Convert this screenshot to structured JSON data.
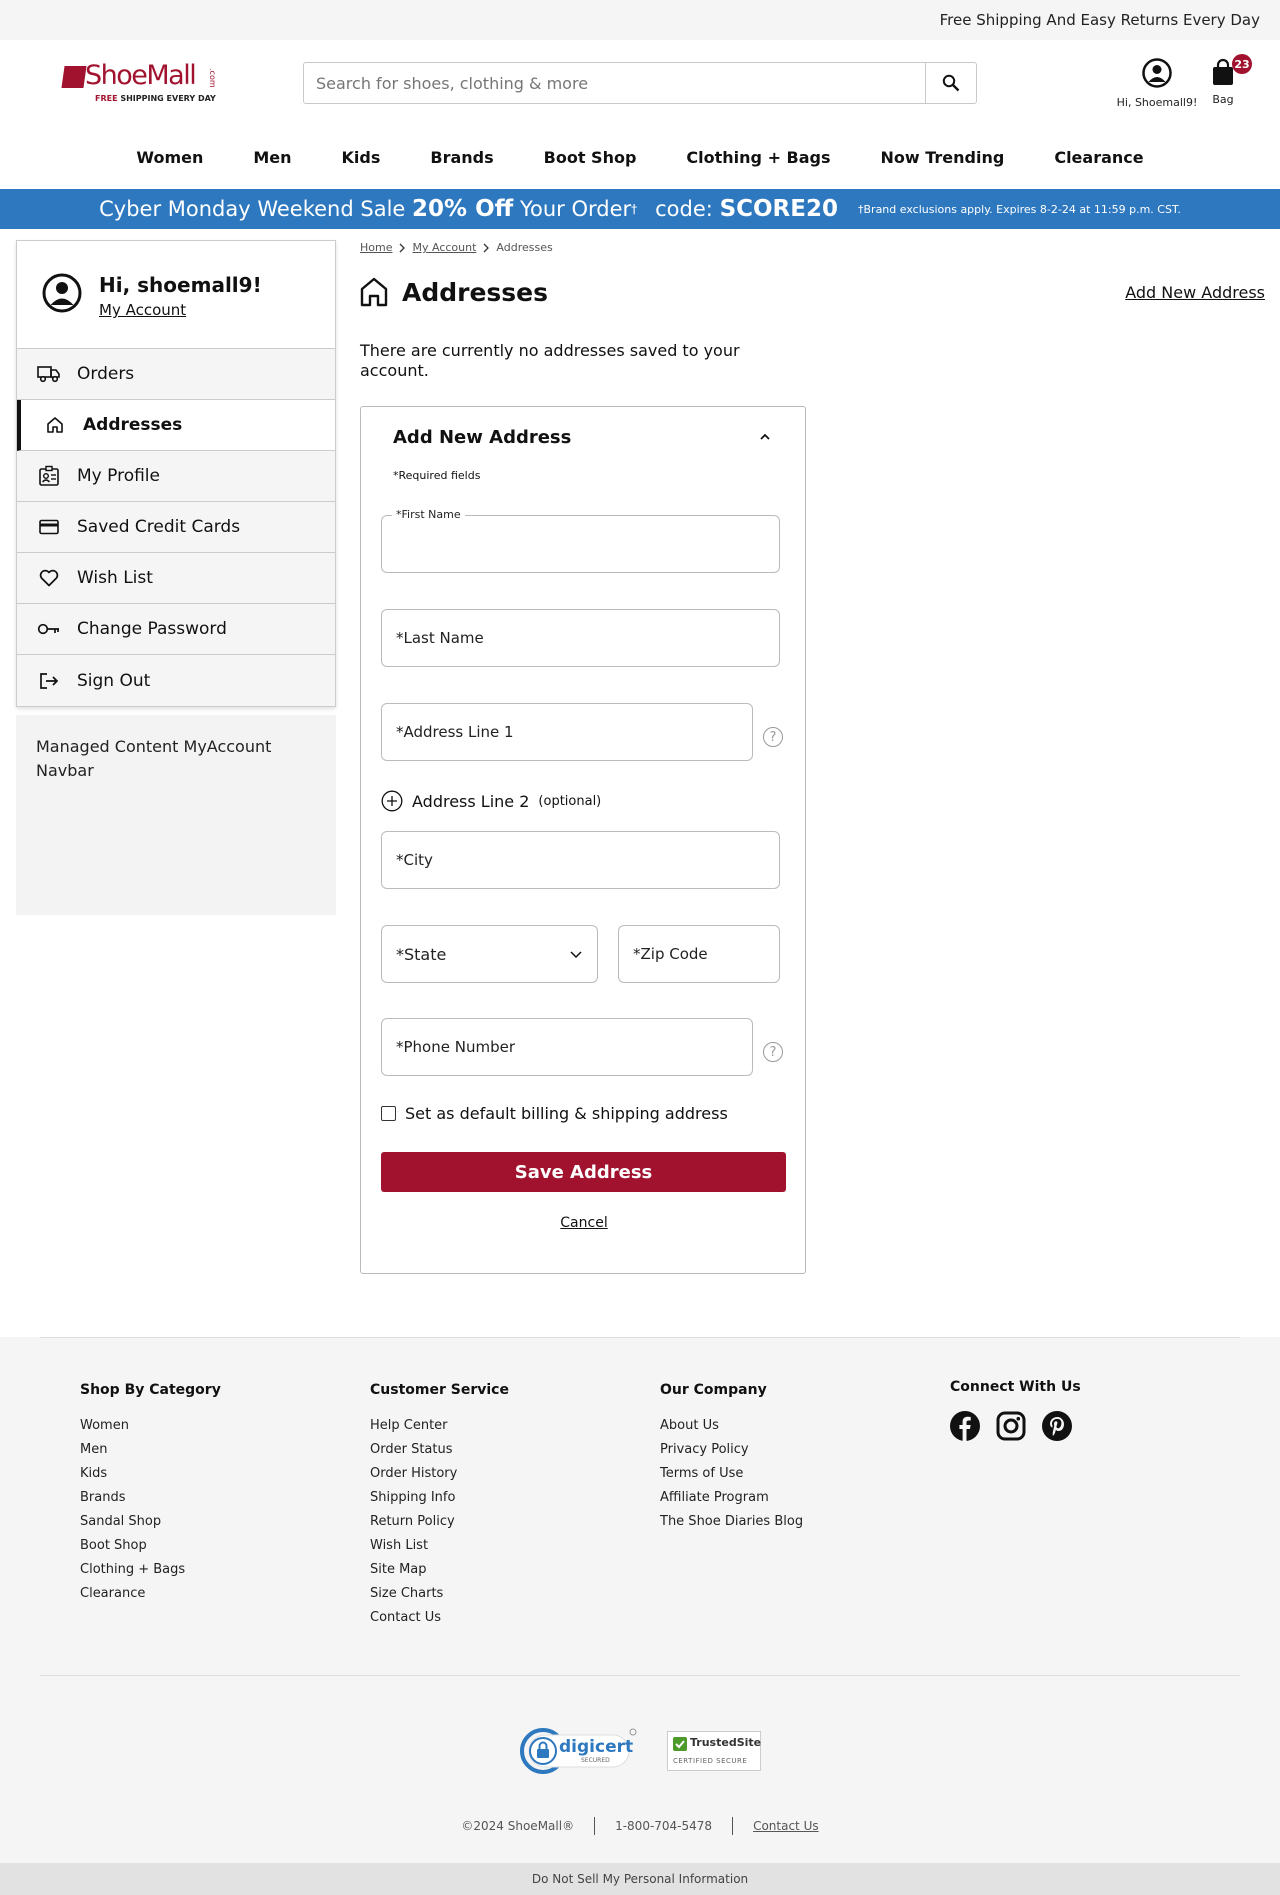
{
  "topbar": {
    "text": "Free Shipping And Easy Returns Every Day"
  },
  "brand": {
    "name": "ShoeMall",
    "domain": ".com",
    "tag_free": "FREE",
    "tag_rest": " SHIPPING EVERY DAY",
    "color": "#a1122f"
  },
  "search": {
    "placeholder": "Search for shoes, clothing & more",
    "icon": "search-icon"
  },
  "account": {
    "label": "Hi, Shoemall9!",
    "icon": "user-circle-icon"
  },
  "bag": {
    "label": "Bag",
    "count": "23",
    "icon": "shopping-bag-icon"
  },
  "nav": [
    "Women",
    "Men",
    "Kids",
    "Brands",
    "Boot Shop",
    "Clothing + Bags",
    "Now Trending",
    "Clearance"
  ],
  "promo": {
    "prefix": "Cyber Monday Weekend Sale ",
    "discount": "20% Off",
    "suffix": " Your Order",
    "dagger": "†",
    "code_label": "code: ",
    "code": "SCORE20",
    "fine": "†Brand exclusions apply. Expires 8-2-24 at 11:59 p.m. CST.",
    "color": "#2e78bf"
  },
  "sidebar": {
    "greeting": "Hi, shoemall9!",
    "account_link": "My Account",
    "items": [
      {
        "label": "Orders",
        "icon": "truck-icon"
      },
      {
        "label": "Addresses",
        "icon": "home-icon",
        "active": true
      },
      {
        "label": "My Profile",
        "icon": "id-card-icon"
      },
      {
        "label": "Saved Credit Cards",
        "icon": "credit-card-icon"
      },
      {
        "label": "Wish List",
        "icon": "heart-icon"
      },
      {
        "label": "Change Password",
        "icon": "key-icon"
      },
      {
        "label": "Sign Out",
        "icon": "sign-out-icon"
      }
    ],
    "managed": "Managed Content MyAccount Navbar"
  },
  "breadcrumb": [
    "Home",
    "My Account",
    "Addresses"
  ],
  "page": {
    "title": "Addresses",
    "add_link": "Add New Address",
    "empty_text": "There are currently no addresses saved to your account."
  },
  "form": {
    "title": "Add New Address",
    "required_note": "*Required fields",
    "first_name": "*First Name",
    "last_name": "*Last Name",
    "address1": "*Address Line 1",
    "address2": "Address Line 2",
    "address2_opt": "(optional)",
    "city": "*City",
    "state": "*State",
    "zip": "*Zip Code",
    "phone": "*Phone Number",
    "default_label": "Set as default billing & shipping address",
    "save": "Save Address",
    "cancel": "Cancel",
    "help": "?"
  },
  "footer": {
    "cols": [
      {
        "title": "Shop By Category",
        "links": [
          "Women",
          "Men",
          "Kids",
          "Brands",
          "Sandal Shop",
          "Boot Shop",
          "Clothing + Bags",
          "Clearance"
        ]
      },
      {
        "title": "Customer Service",
        "links": [
          "Help Center",
          "Order Status",
          "Order History",
          "Shipping Info",
          "Return Policy",
          "Wish List",
          "Site Map",
          "Size Charts",
          "Contact Us"
        ]
      },
      {
        "title": "Our Company",
        "links": [
          "About Us",
          "Privacy Policy",
          "Terms of Use",
          "Affiliate Program",
          "The Shoe Diaries Blog"
        ]
      }
    ],
    "connect_title": "Connect With Us",
    "social": [
      "facebook-icon",
      "instagram-icon",
      "pinterest-icon"
    ],
    "digicert": "digicert",
    "digicert_sub": "SECURED",
    "trusted": "TrustedSite",
    "trusted_sub": "CERTIFIED SECURE",
    "copyright": "©2024 ShoeMall®",
    "phone": "1-800-704-5478",
    "contact": "Contact Us",
    "dns": "Do Not Sell My Personal Information"
  }
}
